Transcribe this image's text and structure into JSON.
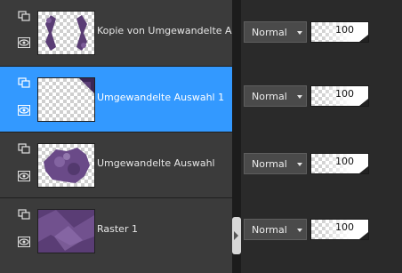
{
  "layers": [
    {
      "name": "Kopie von Umgewandelte Au",
      "blend_mode": "Normal",
      "opacity": "100",
      "selected": false,
      "visible": true
    },
    {
      "name": "Umgewandelte Auswahl 1",
      "blend_mode": "Normal",
      "opacity": "100",
      "selected": true,
      "visible": true
    },
    {
      "name": "Umgewandelte Auswahl",
      "blend_mode": "Normal",
      "opacity": "100",
      "selected": false,
      "visible": true
    },
    {
      "name": "Raster 1",
      "blend_mode": "Normal",
      "opacity": "100",
      "selected": false,
      "visible": true
    }
  ],
  "colors": {
    "panel": "#3b3b3b",
    "selected": "#3399ff",
    "background": "#2a2a2a",
    "thumbnail_purple": "#5a3d75"
  },
  "icons": [
    "layer-link-icon",
    "eye-icon",
    "dropdown-arrow-icon"
  ]
}
